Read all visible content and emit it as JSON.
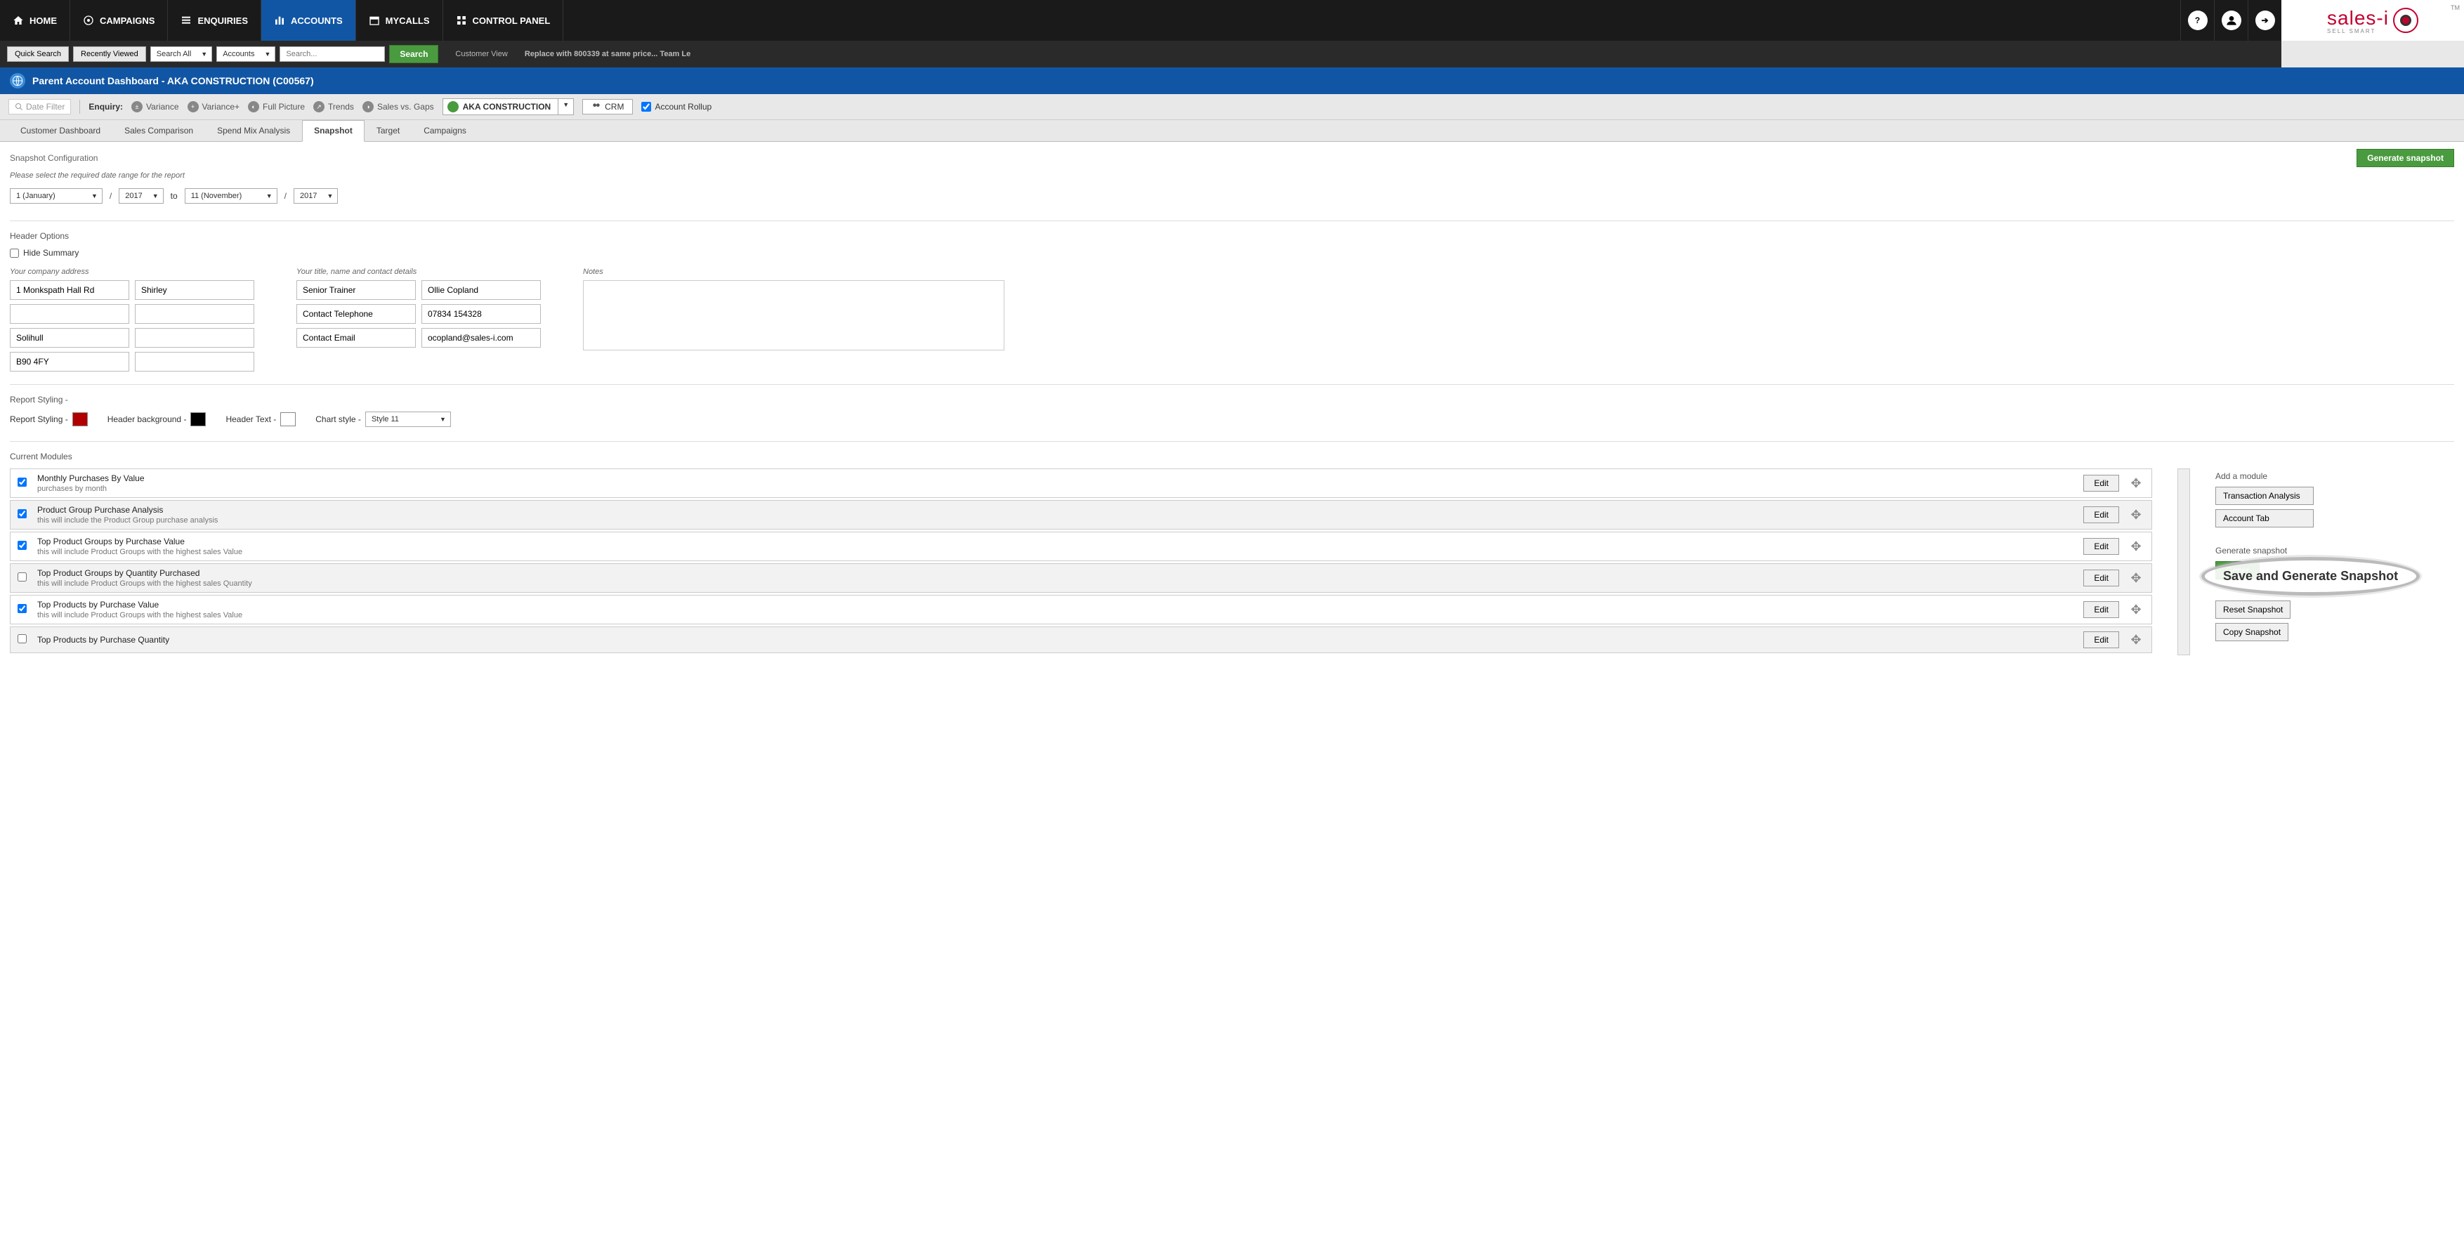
{
  "topnav": {
    "items": [
      {
        "label": "HOME"
      },
      {
        "label": "CAMPAIGNS"
      },
      {
        "label": "ENQUIRIES"
      },
      {
        "label": "ACCOUNTS",
        "active": true
      },
      {
        "label": "MYCALLS"
      },
      {
        "label": "CONTROL PANEL"
      }
    ],
    "help_icon": "?",
    "logo": "sales-i",
    "logo_sub": "SELL SMART",
    "tm": "TM"
  },
  "searchbar": {
    "quick_search": "Quick Search",
    "recently_viewed": "Recently Viewed",
    "search_all": "Search All",
    "accounts": "Accounts",
    "search_placeholder": "Search...",
    "search_btn": "Search",
    "customer_view": "Customer View",
    "replace_text": "Replace with 800339 at same price... Team Le"
  },
  "titlebar": {
    "text": "Parent Account Dashboard - AKA CONSTRUCTION (C00567)"
  },
  "enquirybar": {
    "date_filter": "Date Filter",
    "enquiry": "Enquiry:",
    "items": [
      "Variance",
      "Variance+",
      "Full Picture",
      "Trends",
      "Sales vs. Gaps"
    ],
    "account": "AKA CONSTRUCTION",
    "crm": "CRM",
    "rollup": "Account Rollup"
  },
  "tabs": [
    "Customer Dashboard",
    "Sales Comparison",
    "Spend Mix Analysis",
    "Snapshot",
    "Target",
    "Campaigns"
  ],
  "tabs_active_index": 3,
  "snapshot": {
    "title": "Snapshot Configuration",
    "generate_btn": "Generate snapshot",
    "instruction": "Please select the required date range for the report",
    "from_month": "1 (January)",
    "from_year": "2017",
    "to": "to",
    "to_month": "11 (November)",
    "to_year": "2017"
  },
  "header_options": {
    "title": "Header Options",
    "hide_summary": "Hide Summary",
    "address_label": "Your company address",
    "address": [
      "1 Monkspath Hall Rd",
      "Shirley",
      "",
      "",
      "Solihull",
      "",
      "B90 4FY",
      ""
    ],
    "contact_label": "Your title, name and contact details",
    "contact_labels": [
      "Senior Trainer",
      "Contact Telephone",
      "Contact Email"
    ],
    "contact_values": [
      "Ollie Copland",
      "07834 154328",
      "ocopland@sales-i.com"
    ],
    "notes_label": "Notes"
  },
  "styling": {
    "title": "Report Styling -",
    "report_styling": "Report Styling -",
    "header_bg": "Header background -",
    "header_text": "Header Text -",
    "chart_style": "Chart style -",
    "chart_style_value": "Style 11"
  },
  "modules": {
    "title": "Current Modules",
    "edit": "Edit",
    "list": [
      {
        "title": "Monthly Purchases By Value",
        "desc": "purchases by month",
        "checked": true
      },
      {
        "title": "Product Group Purchase Analysis",
        "desc": "this will include the Product Group purchase analysis",
        "checked": true
      },
      {
        "title": "Top Product Groups by Purchase Value",
        "desc": "this will include Product Groups with the highest sales Value",
        "checked": true
      },
      {
        "title": "Top Product Groups by Quantity Purchased",
        "desc": "this will include Product Groups with the highest sales Quantity",
        "checked": false
      },
      {
        "title": "Top Products by Purchase Value",
        "desc": "this will include Product Groups with the highest sales Value",
        "checked": true
      },
      {
        "title": "Top Products by Purchase Quantity",
        "desc": "",
        "checked": false
      }
    ]
  },
  "sidebar": {
    "add_module": "Add a module",
    "transaction_analysis": "Transaction Analysis",
    "account_tab": "Account Tab",
    "generate_snapshot": "Generate snapshot",
    "generate_btn_partial": "Gener",
    "save_generate": "Save and Generate Snapshot",
    "reset": "Reset Snapshot",
    "copy": "Copy Snapshot"
  }
}
